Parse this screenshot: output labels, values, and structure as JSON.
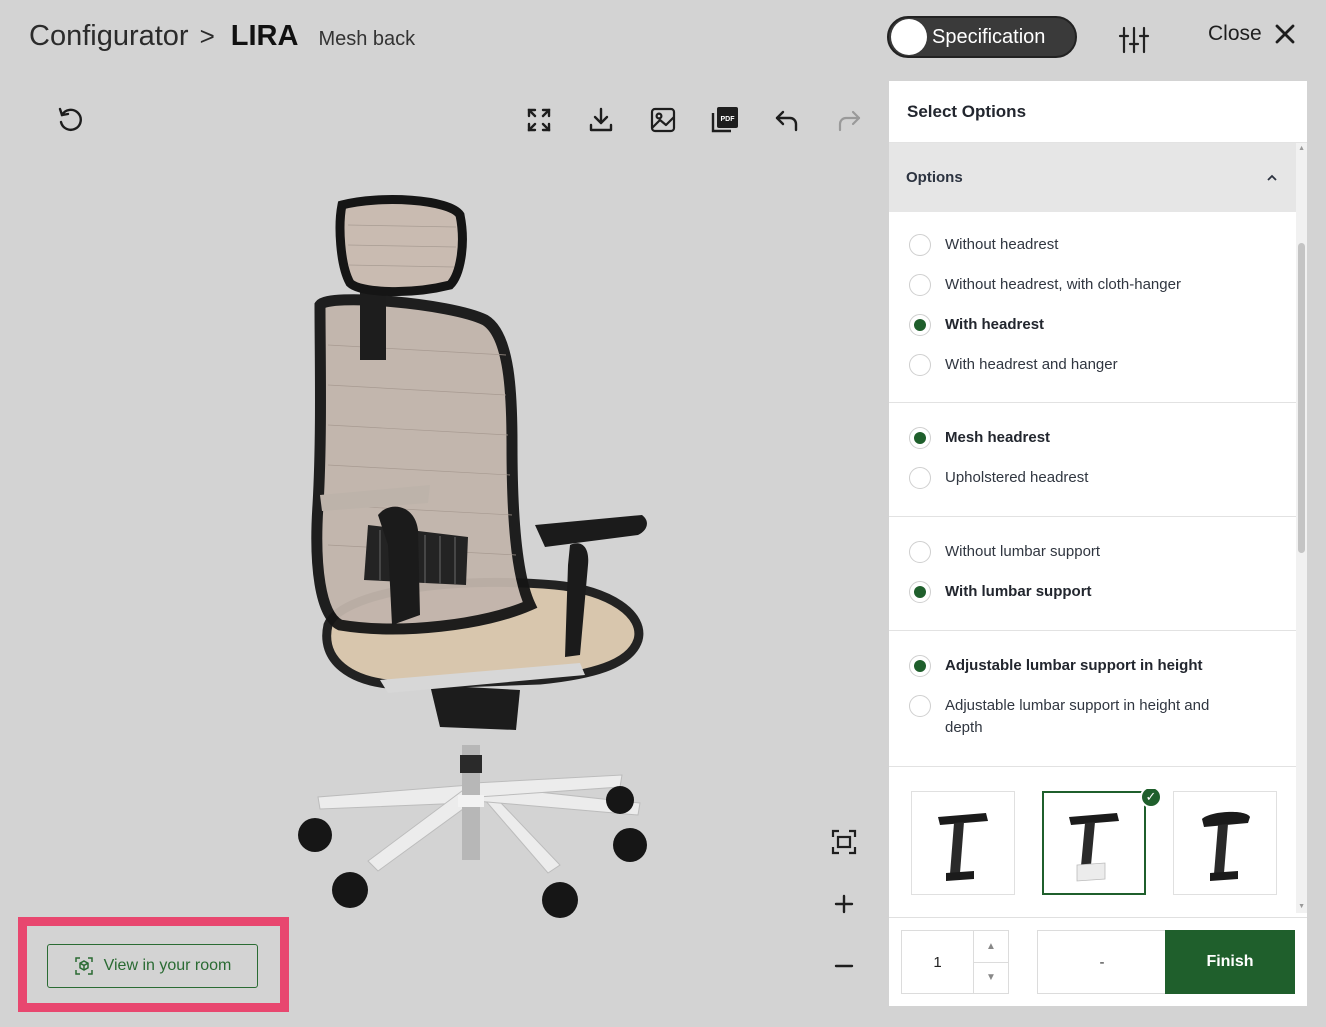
{
  "breadcrumb": {
    "root": "Configurator",
    "separator": ">",
    "product": "LIRA",
    "variant": "Mesh back"
  },
  "header": {
    "spec_label": "Specification",
    "close_label": "Close"
  },
  "view_in_room": {
    "label": "View in your room"
  },
  "panel": {
    "title": "Select Options",
    "section_label": "Options",
    "groups": [
      {
        "options": [
          {
            "label": "Without headrest",
            "selected": false
          },
          {
            "label": "Without headrest, with cloth-hanger",
            "selected": false
          },
          {
            "label": "With headrest",
            "selected": true
          },
          {
            "label": "With headrest and hanger",
            "selected": false
          }
        ]
      },
      {
        "options": [
          {
            "label": "Mesh headrest",
            "selected": true
          },
          {
            "label": "Upholstered headrest",
            "selected": false
          }
        ]
      },
      {
        "options": [
          {
            "label": "Without lumbar support",
            "selected": false
          },
          {
            "label": "With lumbar support",
            "selected": true
          }
        ]
      },
      {
        "options": [
          {
            "label": "Adjustable lumbar support in height",
            "selected": true
          },
          {
            "label": "Adjustable lumbar support in height and depth",
            "selected": false
          }
        ]
      }
    ],
    "armrest_thumbs": [
      {
        "icon": "armrest-black-icon",
        "selected": false
      },
      {
        "icon": "armrest-white-icon",
        "selected": true
      },
      {
        "icon": "armrest-soft-icon",
        "selected": false
      }
    ]
  },
  "footer": {
    "quantity": "1",
    "price": "-",
    "finish_label": "Finish"
  },
  "colors": {
    "accent": "#1f5f2c",
    "highlight": "#e8476f",
    "background": "#d3d3d3"
  }
}
